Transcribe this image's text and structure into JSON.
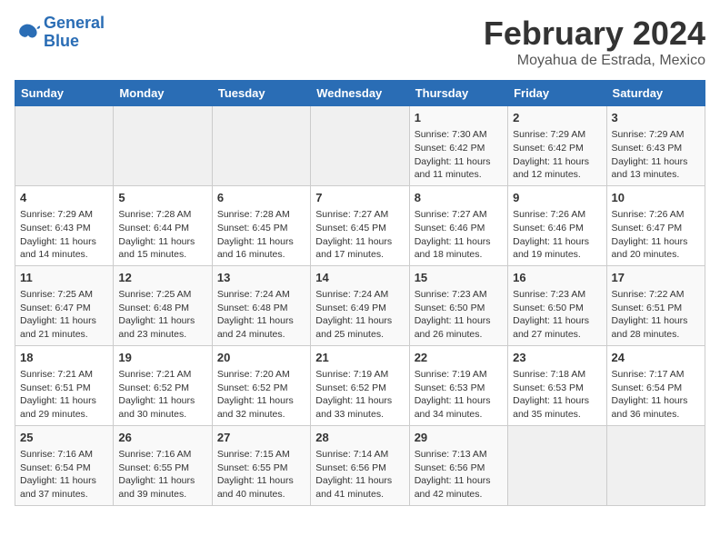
{
  "logo": {
    "line1": "General",
    "line2": "Blue"
  },
  "title": "February 2024",
  "subtitle": "Moyahua de Estrada, Mexico",
  "days_header": [
    "Sunday",
    "Monday",
    "Tuesday",
    "Wednesday",
    "Thursday",
    "Friday",
    "Saturday"
  ],
  "weeks": [
    [
      {
        "day": "",
        "info": ""
      },
      {
        "day": "",
        "info": ""
      },
      {
        "day": "",
        "info": ""
      },
      {
        "day": "",
        "info": ""
      },
      {
        "day": "1",
        "info": "Sunrise: 7:30 AM\nSunset: 6:42 PM\nDaylight: 11 hours\nand 11 minutes."
      },
      {
        "day": "2",
        "info": "Sunrise: 7:29 AM\nSunset: 6:42 PM\nDaylight: 11 hours\nand 12 minutes."
      },
      {
        "day": "3",
        "info": "Sunrise: 7:29 AM\nSunset: 6:43 PM\nDaylight: 11 hours\nand 13 minutes."
      }
    ],
    [
      {
        "day": "4",
        "info": "Sunrise: 7:29 AM\nSunset: 6:43 PM\nDaylight: 11 hours\nand 14 minutes."
      },
      {
        "day": "5",
        "info": "Sunrise: 7:28 AM\nSunset: 6:44 PM\nDaylight: 11 hours\nand 15 minutes."
      },
      {
        "day": "6",
        "info": "Sunrise: 7:28 AM\nSunset: 6:45 PM\nDaylight: 11 hours\nand 16 minutes."
      },
      {
        "day": "7",
        "info": "Sunrise: 7:27 AM\nSunset: 6:45 PM\nDaylight: 11 hours\nand 17 minutes."
      },
      {
        "day": "8",
        "info": "Sunrise: 7:27 AM\nSunset: 6:46 PM\nDaylight: 11 hours\nand 18 minutes."
      },
      {
        "day": "9",
        "info": "Sunrise: 7:26 AM\nSunset: 6:46 PM\nDaylight: 11 hours\nand 19 minutes."
      },
      {
        "day": "10",
        "info": "Sunrise: 7:26 AM\nSunset: 6:47 PM\nDaylight: 11 hours\nand 20 minutes."
      }
    ],
    [
      {
        "day": "11",
        "info": "Sunrise: 7:25 AM\nSunset: 6:47 PM\nDaylight: 11 hours\nand 21 minutes."
      },
      {
        "day": "12",
        "info": "Sunrise: 7:25 AM\nSunset: 6:48 PM\nDaylight: 11 hours\nand 23 minutes."
      },
      {
        "day": "13",
        "info": "Sunrise: 7:24 AM\nSunset: 6:48 PM\nDaylight: 11 hours\nand 24 minutes."
      },
      {
        "day": "14",
        "info": "Sunrise: 7:24 AM\nSunset: 6:49 PM\nDaylight: 11 hours\nand 25 minutes."
      },
      {
        "day": "15",
        "info": "Sunrise: 7:23 AM\nSunset: 6:50 PM\nDaylight: 11 hours\nand 26 minutes."
      },
      {
        "day": "16",
        "info": "Sunrise: 7:23 AM\nSunset: 6:50 PM\nDaylight: 11 hours\nand 27 minutes."
      },
      {
        "day": "17",
        "info": "Sunrise: 7:22 AM\nSunset: 6:51 PM\nDaylight: 11 hours\nand 28 minutes."
      }
    ],
    [
      {
        "day": "18",
        "info": "Sunrise: 7:21 AM\nSunset: 6:51 PM\nDaylight: 11 hours\nand 29 minutes."
      },
      {
        "day": "19",
        "info": "Sunrise: 7:21 AM\nSunset: 6:52 PM\nDaylight: 11 hours\nand 30 minutes."
      },
      {
        "day": "20",
        "info": "Sunrise: 7:20 AM\nSunset: 6:52 PM\nDaylight: 11 hours\nand 32 minutes."
      },
      {
        "day": "21",
        "info": "Sunrise: 7:19 AM\nSunset: 6:52 PM\nDaylight: 11 hours\nand 33 minutes."
      },
      {
        "day": "22",
        "info": "Sunrise: 7:19 AM\nSunset: 6:53 PM\nDaylight: 11 hours\nand 34 minutes."
      },
      {
        "day": "23",
        "info": "Sunrise: 7:18 AM\nSunset: 6:53 PM\nDaylight: 11 hours\nand 35 minutes."
      },
      {
        "day": "24",
        "info": "Sunrise: 7:17 AM\nSunset: 6:54 PM\nDaylight: 11 hours\nand 36 minutes."
      }
    ],
    [
      {
        "day": "25",
        "info": "Sunrise: 7:16 AM\nSunset: 6:54 PM\nDaylight: 11 hours\nand 37 minutes."
      },
      {
        "day": "26",
        "info": "Sunrise: 7:16 AM\nSunset: 6:55 PM\nDaylight: 11 hours\nand 39 minutes."
      },
      {
        "day": "27",
        "info": "Sunrise: 7:15 AM\nSunset: 6:55 PM\nDaylight: 11 hours\nand 40 minutes."
      },
      {
        "day": "28",
        "info": "Sunrise: 7:14 AM\nSunset: 6:56 PM\nDaylight: 11 hours\nand 41 minutes."
      },
      {
        "day": "29",
        "info": "Sunrise: 7:13 AM\nSunset: 6:56 PM\nDaylight: 11 hours\nand 42 minutes."
      },
      {
        "day": "",
        "info": ""
      },
      {
        "day": "",
        "info": ""
      }
    ]
  ]
}
